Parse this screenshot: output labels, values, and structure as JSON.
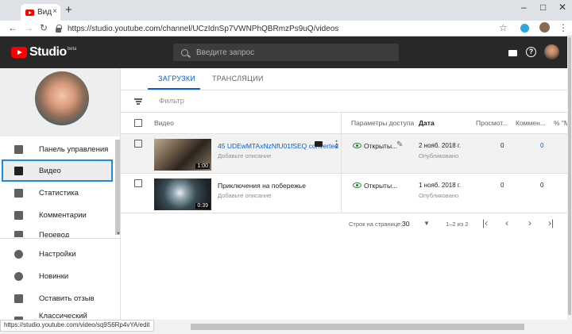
{
  "browser": {
    "tab_title": "Вид",
    "tab_close": "×",
    "new_tab": "+",
    "url": "https://studio.youtube.com/channel/UCzIdnSp7VWNPhQBRmzPs9uQ/videos",
    "status_url": "https://studio.youtube.com/video/sq9S6Rp4vYA/edit"
  },
  "header": {
    "logo_text": "Studio",
    "logo_beta": "beta",
    "search_placeholder": "Введите запрос",
    "help": "?"
  },
  "sidebar": {
    "items": [
      {
        "label": "Панель управления",
        "icon": "dashboard-icon"
      },
      {
        "label": "Видео",
        "icon": "video-library-icon",
        "active": true
      },
      {
        "label": "Статистика",
        "icon": "analytics-icon"
      },
      {
        "label": "Комментарии",
        "icon": "comments-icon"
      },
      {
        "label": "Перевод",
        "icon": "translation-icon"
      }
    ],
    "bottom_items": [
      {
        "label": "Настройки",
        "icon": "gear-icon"
      },
      {
        "label": "Новинки",
        "icon": "badge-icon"
      },
      {
        "label": "Оставить отзыв",
        "icon": "feedback-icon"
      },
      {
        "label": "Классический интерф",
        "icon": "classic-icon"
      }
    ]
  },
  "main": {
    "tabs": [
      {
        "label": "ЗАГРУЗКИ",
        "active": true
      },
      {
        "label": "ТРАНСЛЯЦИИ",
        "active": false
      }
    ],
    "filter_label": "Фильтр",
    "columns": {
      "video": "Видео",
      "visibility": "Параметры доступа",
      "date": "Дата",
      "views": "Просмот...",
      "comments": "Коммен...",
      "likes": "% \"Мн"
    },
    "rows": [
      {
        "title": "45 UDEwMTAxNzNfU01fSEQ converted",
        "description": "Добавьте описание",
        "duration": "1:00",
        "visibility": "Открыты...",
        "date": "2 нояб. 2018 г.",
        "status": "Опубликовано",
        "views": "0",
        "comments": "0"
      },
      {
        "title": "Приключения на побережье",
        "description": "Добавьте описание",
        "duration": "0:39",
        "visibility": "Открыты...",
        "date": "1 нояб. 2018 г.",
        "status": "Опубликовано",
        "views": "0",
        "comments": "0"
      }
    ],
    "pager": {
      "rows_label": "Строк на странице:",
      "rows_value": "30",
      "range": "1–2 из 2"
    }
  },
  "colors": {
    "accent": "#065fd4",
    "header_bg": "#282828",
    "active_outline": "#1e88e5",
    "public_green": "#2e7d32"
  }
}
